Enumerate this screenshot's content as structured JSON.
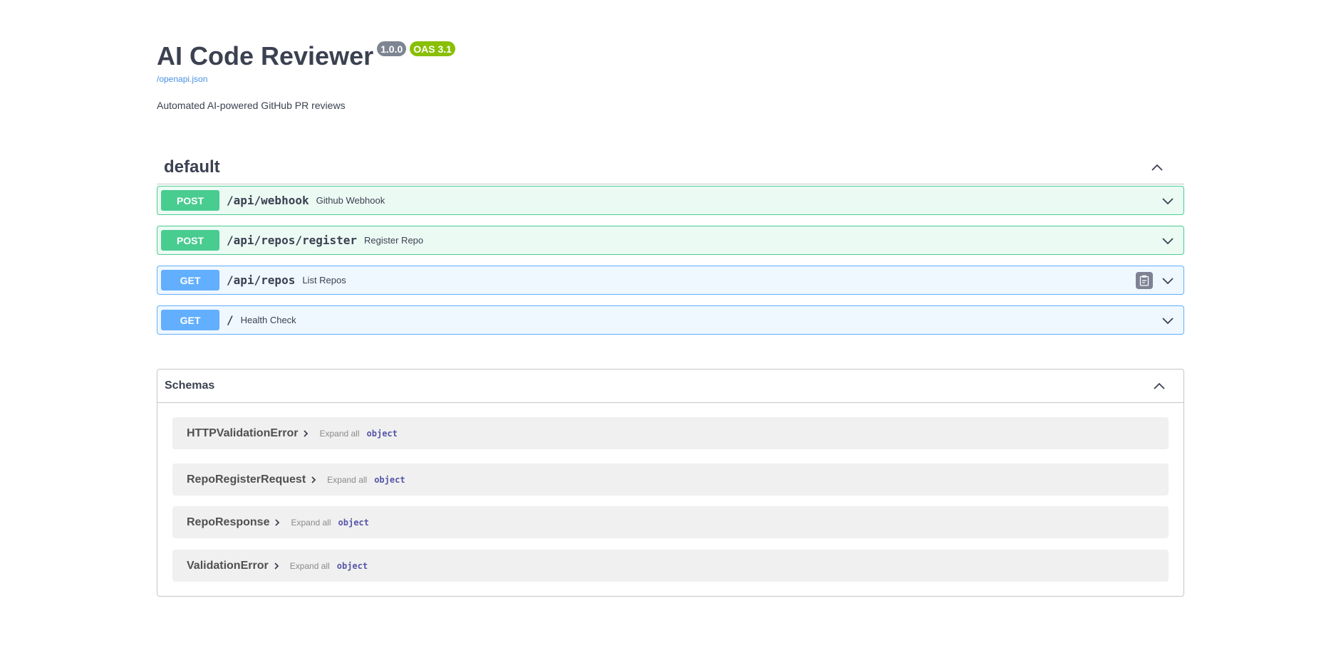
{
  "info": {
    "title": "AI Code Reviewer",
    "version_badge": "1.0.0",
    "oas_badge": "OAS 3.1",
    "spec_link": "/openapi.json",
    "description": "Automated AI-powered GitHub PR reviews"
  },
  "tag": {
    "name": "default"
  },
  "operations": [
    {
      "method": "POST",
      "path": "/api/webhook",
      "summary": "Github Webhook"
    },
    {
      "method": "POST",
      "path": "/api/repos/register",
      "summary": "Register Repo"
    },
    {
      "method": "GET",
      "path": "/api/repos",
      "summary": "List Repos"
    },
    {
      "method": "GET",
      "path": "/",
      "summary": "Health Check"
    }
  ],
  "schemas": {
    "title": "Schemas",
    "expand_all_label": "Expand all",
    "models": [
      {
        "name": "HTTPValidationError",
        "type": "object"
      },
      {
        "name": "RepoRegisterRequest",
        "type": "object"
      },
      {
        "name": "RepoResponse",
        "type": "object"
      },
      {
        "name": "ValidationError",
        "type": "object"
      }
    ]
  },
  "colors": {
    "post": "#49cc90",
    "get": "#61affe",
    "oas_badge": "#89bf04",
    "version_badge": "#7d8492",
    "link": "#4990e2"
  },
  "icons": {
    "collapse": "chevron-up-icon",
    "expand": "chevron-down-icon",
    "copy": "clipboard-icon",
    "model_arrow": "chevron-right-icon"
  }
}
